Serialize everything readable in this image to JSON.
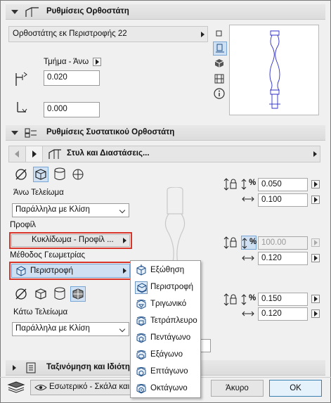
{
  "colors": {
    "accent_blue": "#2d6db5",
    "highlight_red": "#d9362b",
    "selected_bg": "#cfe0f3"
  },
  "post_settings": {
    "title": "Ρυθμίσεις Ορθοστάτη",
    "post_type": "Ορθοστάτης εκ Περιστροφής 22",
    "segment_label": "Τμήμα - Άνω",
    "offset_value": "0.020",
    "height_value": "0.000"
  },
  "component_settings": {
    "title": "Ρυθμίσεις Συστατικού Ορθοστάτη",
    "page_select": "Στυλ και Διαστάσεις...",
    "top_finish_label": "Άνω Τελείωμα",
    "top_finish_value": "Παράλληλα με Κλίση",
    "profile_label": "Προφίλ",
    "profile_value": "Κυκλίδωμα - Προφίλ ...",
    "geometry_label": "Μέθοδος Γεωμετρίας",
    "geometry_value": "Περιστροφή",
    "bottom_finish_label": "Κάτω Τελείωμα",
    "bottom_finish_value": "Παράλληλα με Κλίση",
    "top_height": "0.050",
    "top_width": "0.100",
    "mid_percent": "100.00",
    "mid_width": "0.120",
    "bot_height": "0.150",
    "bot_width": "0.120",
    "percent_symbol": "%"
  },
  "geometry_menu": {
    "items": [
      "Εξώθηση",
      "Περιστροφή",
      "Τριγωνικό",
      "Τετράπλευρο",
      "Πεντάγωνο",
      "Εξάγωνο",
      "Επτάγωνο",
      "Οκτάγωνο"
    ],
    "selected": "Περιστροφή"
  },
  "classification": {
    "title": "Ταξινόμηση και Ιδιότητα"
  },
  "footer": {
    "layer_value": "Εσωτερικό - Σκάλα και ...",
    "cancel_label": "Άκυρο",
    "ok_label": "ΟΚ"
  }
}
